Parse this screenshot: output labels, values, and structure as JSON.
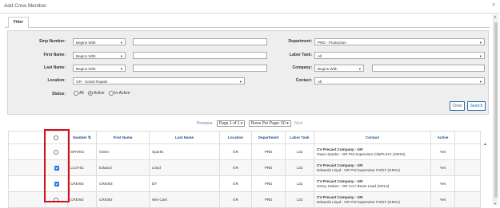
{
  "window": {
    "title": "Add Crew Member",
    "close_glyph": "×"
  },
  "tabs": [
    {
      "label": "Filter"
    }
  ],
  "filter": {
    "emp_number": {
      "label": "Emp Number:",
      "operator": "Begins With",
      "value": ""
    },
    "first_name": {
      "label": "First Name:",
      "operator": "Begins With",
      "value": ""
    },
    "last_name": {
      "label": "Last Name:",
      "operator": "Begins With",
      "value": ""
    },
    "location": {
      "label": "Location:",
      "value": "GR - Grand Rapids"
    },
    "department": {
      "label": "Department:",
      "value": "PRD - Production"
    },
    "labor_task": {
      "label": "Labor Task:",
      "value": "All"
    },
    "company": {
      "label": "Company:",
      "operator": "Begins With",
      "value": ""
    },
    "contact": {
      "label": "Contact:",
      "value": "All"
    },
    "status": {
      "label": "Status:",
      "options": [
        "All",
        "Active",
        "In-Active"
      ],
      "selected": "Active"
    },
    "clear_label": "Clear",
    "search_label": "Search"
  },
  "pager": {
    "previous": "Previous",
    "page": "Page 1 of 1",
    "rows_per_page": "Rows Per Page: 50",
    "next": "Next"
  },
  "grid": {
    "columns": [
      "",
      "Number",
      "First Name",
      "Last Name",
      "Location",
      "Department",
      "Labor Task",
      "Contact",
      "Active"
    ],
    "rows": [
      {
        "checked": false,
        "number": "SPAR01",
        "first": "Owen",
        "last": "Sparks",
        "location": "GR",
        "department": "PRD",
        "labor": "L32",
        "contact_company": "CV Precast Company - GR",
        "contact_detail": "Owen Sparks - GR Prd Supervisor C/B/FL/HC (GRS2)",
        "active": "Yes"
      },
      {
        "checked": true,
        "number": "LLOY01",
        "first": "Edward",
        "last": "Lloyd",
        "location": "GR",
        "department": "PRD",
        "labor": "L32",
        "contact_company": "CV Precast Company - GR",
        "contact_detail": "Edwards Lloyd - GR Prd Supervisor FS/DT (GRS1)",
        "active": "Yes"
      },
      {
        "checked": true,
        "number": "CREW3",
        "first": "CREW3",
        "last": "DT",
        "location": "GR",
        "department": "PRD",
        "labor": "L32",
        "contact_company": "CV Precast Company - GR",
        "contact_detail": "Henry Stokes - GR Col / Beam Lead (GRL3)",
        "active": "Yes"
      },
      {
        "checked": false,
        "number": "CREW2",
        "first": "CREW2",
        "last": "Wet Cast",
        "location": "GR",
        "department": "PRD",
        "labor": "L32",
        "contact_company": "CV Precast Company - GR",
        "contact_detail": "Edwards Lloyd - GR Prd Supervisor FS/DT (GRS1)",
        "active": "Yes"
      }
    ]
  },
  "icons": {
    "sort": "sort-icon",
    "caret": "▾",
    "scroll_up": "▲",
    "scroll_down": "▼"
  },
  "colors": {
    "highlight": "#d0111b",
    "link": "#1a4d8f",
    "accent": "#1a73e8"
  }
}
